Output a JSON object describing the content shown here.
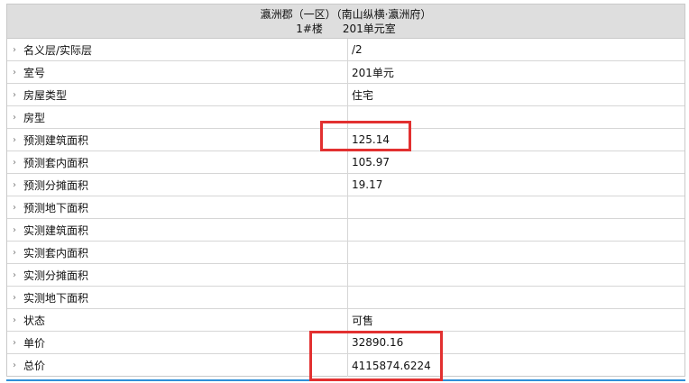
{
  "header": {
    "title": "瀛洲郡（一区）（南山纵横·瀛洲府）",
    "building": "1#楼",
    "unit": "201单元室"
  },
  "rows": [
    {
      "label": "名义层/实际层",
      "value": "/2"
    },
    {
      "label": "室号",
      "value": "201单元"
    },
    {
      "label": "房屋类型",
      "value": "住宅"
    },
    {
      "label": "房型",
      "value": ""
    },
    {
      "label": "预测建筑面积",
      "value": "125.14"
    },
    {
      "label": "预测套内面积",
      "value": "105.97"
    },
    {
      "label": "预测分摊面积",
      "value": "19.17"
    },
    {
      "label": "预测地下面积",
      "value": ""
    },
    {
      "label": "实测建筑面积",
      "value": ""
    },
    {
      "label": "实测套内面积",
      "value": ""
    },
    {
      "label": "实测分摊面积",
      "value": ""
    },
    {
      "label": "实测地下面积",
      "value": ""
    },
    {
      "label": "状态",
      "value": "可售"
    },
    {
      "label": "单价",
      "value": "32890.16"
    },
    {
      "label": "总价",
      "value": "4115874.6224"
    }
  ],
  "colors": {
    "highlight": "#e23030",
    "header_bg": "#dedede",
    "accent_line": "#2f8fd8"
  },
  "icons": {
    "row_arrow": "chevron-right-icon"
  }
}
